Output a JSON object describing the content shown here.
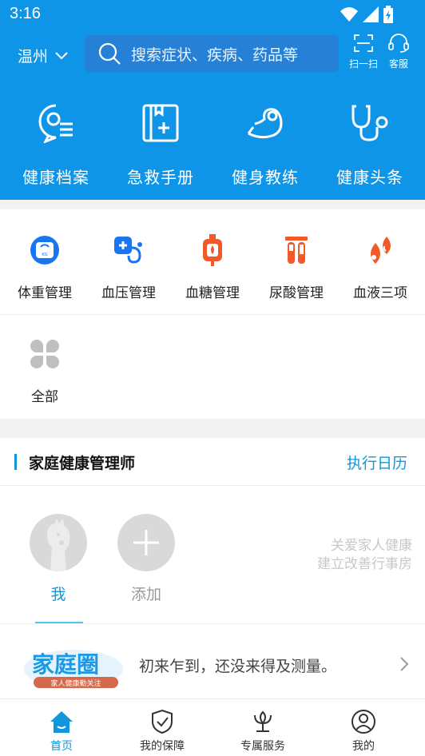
{
  "status": {
    "time": "3:16"
  },
  "header": {
    "city": "温州",
    "search_placeholder": "搜索症状、疾病、药品等",
    "scan_label": "扫一扫",
    "service_label": "客服"
  },
  "quick_actions": [
    {
      "label": "健康档案",
      "icon": "health-record-icon"
    },
    {
      "label": "急救手册",
      "icon": "first-aid-book-icon"
    },
    {
      "label": "健身教练",
      "icon": "fitness-coach-icon"
    },
    {
      "label": "健康头条",
      "icon": "stethoscope-icon"
    }
  ],
  "categories": [
    {
      "label": "体重管理",
      "icon": "scale-icon",
      "color": "#1976f0"
    },
    {
      "label": "血压管理",
      "icon": "blood-pressure-icon",
      "color": "#1976f0"
    },
    {
      "label": "血糖管理",
      "icon": "blood-sugar-icon",
      "color": "#f25a2a"
    },
    {
      "label": "尿酸管理",
      "icon": "test-tubes-icon",
      "color": "#f25a2a"
    },
    {
      "label": "血液三项",
      "icon": "blood-drops-icon",
      "color": "#f25a2a"
    },
    {
      "label": "全部",
      "icon": "grid-icon",
      "color": "#bfbfbf"
    }
  ],
  "family": {
    "title": "家庭健康管理师",
    "link": "执行日历",
    "members": [
      {
        "label": "我",
        "active": true
      },
      {
        "label": "添加",
        "active": false
      }
    ],
    "tagline_1": "关爱家人健康",
    "tagline_2": "建立改善行事房",
    "banner_logo_text": "家庭圈",
    "banner_logo_sub": "家人健康勤关注",
    "banner_message": "初来乍到，还没来得及测量。"
  },
  "tabs": [
    {
      "label": "首页",
      "active": true
    },
    {
      "label": "我的保障",
      "active": false
    },
    {
      "label": "专属服务",
      "active": false
    },
    {
      "label": "我的",
      "active": false
    }
  ],
  "colors": {
    "primary": "#0f95e8",
    "accent": "#1296db",
    "orange": "#f25a2a"
  }
}
